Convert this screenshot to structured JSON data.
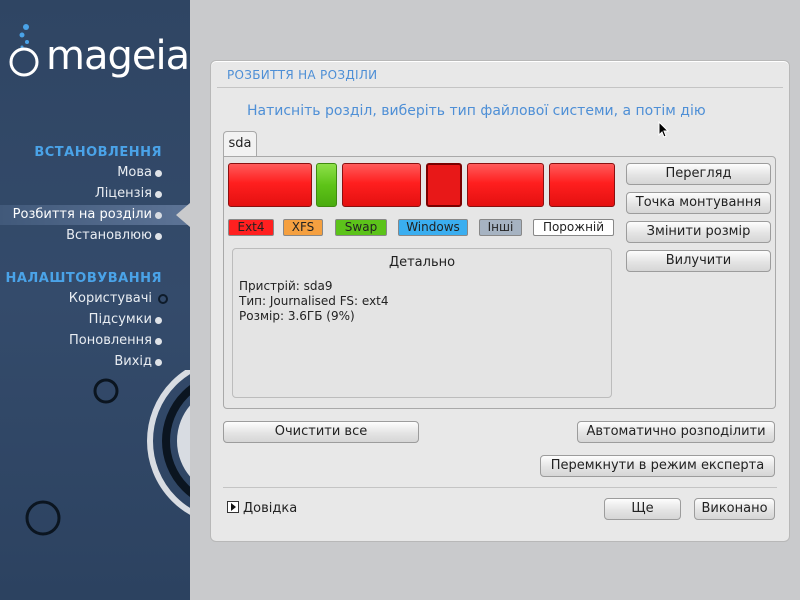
{
  "sidebar": {
    "logo_text": "mageia",
    "sections": [
      {
        "title": "ВСТАНОВЛЕННЯ",
        "items": [
          {
            "label": "Мова"
          },
          {
            "label": "Ліцензія"
          },
          {
            "label": "Розбиття на розділи"
          },
          {
            "label": "Встановлюю"
          }
        ]
      },
      {
        "title": "НАЛАШТОВУВАННЯ",
        "items": [
          {
            "label": "Користувачі"
          },
          {
            "label": "Підсумки"
          },
          {
            "label": "Поновлення"
          },
          {
            "label": "Вихід"
          }
        ]
      }
    ]
  },
  "panel": {
    "title": "РОЗБИТТЯ НА РОЗДІЛИ",
    "instruction": "Натисніть розділ, виберіть тип файлової системи, а потім дію",
    "tab": "sda",
    "partitions": [
      {
        "type": "ext4"
      },
      {
        "type": "swap"
      },
      {
        "type": "ext4"
      },
      {
        "type": "ext4",
        "selected": true
      },
      {
        "type": "ext4"
      },
      {
        "type": "ext4"
      }
    ],
    "legend": [
      {
        "label": "Ext4",
        "color": "#ff2020"
      },
      {
        "label": "XFS",
        "color": "#f5a040"
      },
      {
        "label": "Swap",
        "color": "#5cc31a"
      },
      {
        "label": "Windows",
        "color": "#3aaef0"
      },
      {
        "label": "Інші",
        "color": "#a6b3c2"
      },
      {
        "label": "Порожній",
        "color": "#ffffff"
      }
    ],
    "details": {
      "title": "Детально",
      "device": "Пристрій: sda9",
      "type": "Тип: Journalised FS: ext4",
      "size": "Розмір: 3.6ГБ (9%)"
    },
    "actions": {
      "view": "Перегляд",
      "mount_point": "Точка монтування",
      "resize": "Змінити розмір",
      "delete": "Вилучити"
    },
    "clear_all": "Очистити все",
    "auto_allocate": "Автоматично розподілити",
    "expert_mode": "Перемкнути в режим експерта",
    "help": "Довідка",
    "more": "Ще",
    "done": "Виконано"
  },
  "colors": {
    "sidebar_bg": "#2f4563",
    "accent": "#4e8fd6",
    "section_title": "#4aa3e8"
  }
}
